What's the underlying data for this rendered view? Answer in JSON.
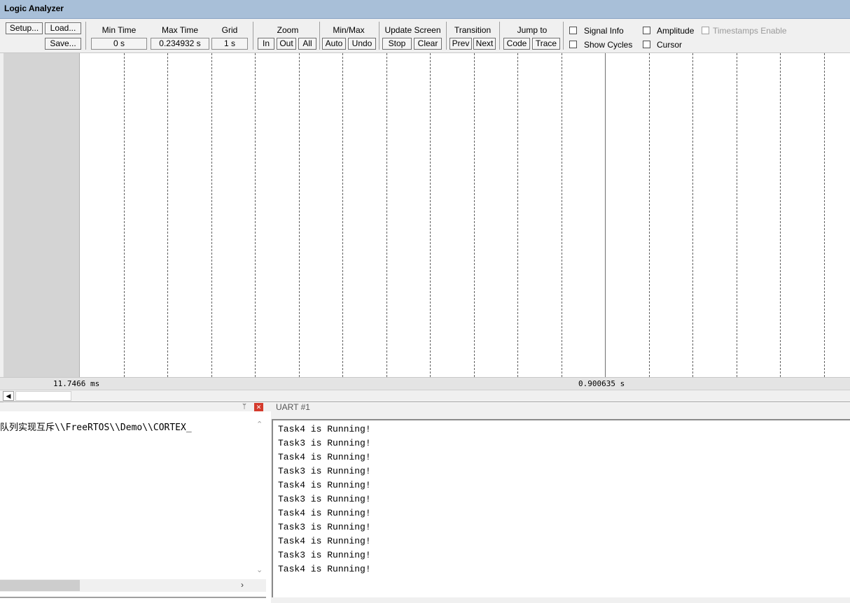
{
  "window": {
    "title": "Logic Analyzer"
  },
  "toolbar": {
    "setup": "Setup...",
    "load": "Load...",
    "save": "Save...",
    "min_time_label": "Min Time",
    "min_time_value": "0 s",
    "max_time_label": "Max Time",
    "max_time_value": "0.234932 s",
    "grid_label": "Grid",
    "grid_value": "1 s",
    "zoom_label": "Zoom",
    "zoom_in": "In",
    "zoom_out": "Out",
    "zoom_all": "All",
    "minmax_label": "Min/Max",
    "minmax_auto": "Auto",
    "minmax_undo": "Undo",
    "update_label": "Update Screen",
    "update_stop": "Stop",
    "update_clear": "Clear",
    "transition_label": "Transition",
    "transition_prev": "Prev",
    "transition_next": "Next",
    "jump_label": "Jump to",
    "jump_code": "Code",
    "jump_trace": "Trace",
    "signal_info": "Signal Info",
    "amplitude": "Amplitude",
    "timestamps": "Timestamps Enable",
    "show_cycles": "Show Cycles",
    "cursor": "Cursor"
  },
  "plot": {
    "time_left": "11.7466 ms",
    "time_right": "0.900635 s"
  },
  "left_pane": {
    "text": "队列实现互斥\\\\FreeRTOS\\\\Demo\\\\CORTEX_"
  },
  "uart": {
    "tab": "UART #1",
    "lines": [
      "Task4 is Running!",
      "Task3 is Running!",
      "Task4 is Running!",
      "Task3 is Running!",
      "Task4 is Running!",
      "Task3 is Running!",
      "Task4 is Running!",
      "Task3 is Running!",
      "Task4 is Running!",
      "Task3 is Running!",
      "Task4 is Running!"
    ]
  },
  "colors": {
    "titlebar": "#a8bfd8",
    "close": "#d43a2c"
  }
}
